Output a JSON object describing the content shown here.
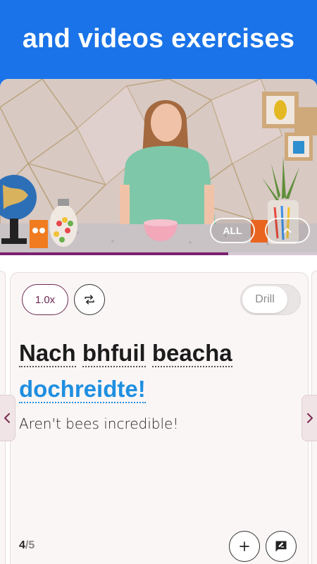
{
  "promo": {
    "headline": "and videos exercises"
  },
  "video": {
    "all_label": "ALL",
    "collapse_icon": "chevron-up-icon",
    "progress": 0.72
  },
  "controls": {
    "speed_label": "1.0x",
    "repeat_icon": "repeat-icon",
    "drill_label": "Drill",
    "drill_on": false
  },
  "exercise": {
    "words": [
      "Nach",
      "bhfuil",
      "beacha",
      "dochreidte!"
    ],
    "highlighted_word_index": 3,
    "translation": "Aren't bees incredible!"
  },
  "footer": {
    "current": "4",
    "total": "/5",
    "add_icon": "plus-icon",
    "note_icon": "note-edit-icon"
  },
  "navigation": {
    "prev_icon": "chevron-left-icon",
    "next_icon": "chevron-right-icon"
  },
  "colors": {
    "brand_blue": "#1a73e8",
    "accent_maroon": "#7b2170",
    "highlight_blue": "#1f8fe0"
  }
}
